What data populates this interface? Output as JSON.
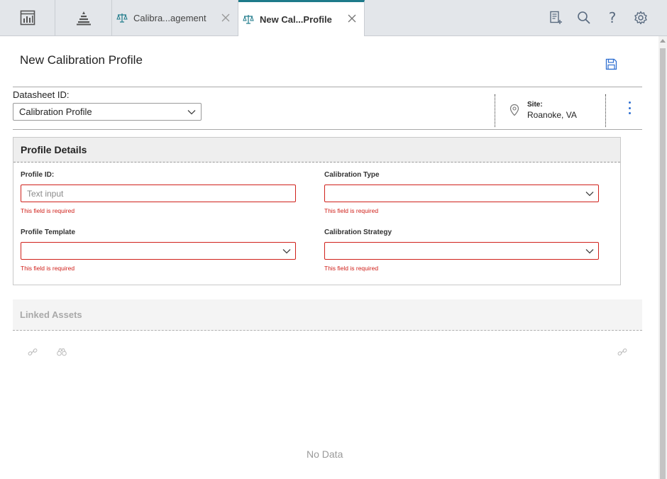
{
  "topbar": {
    "tabs": [
      {
        "label": "Calibra...agement",
        "active": false
      },
      {
        "label": "New Cal...Profile",
        "active": true
      }
    ],
    "icons": [
      "dashboard-icon",
      "pyramid-icon",
      "checklist-add-icon",
      "search-icon",
      "help-icon",
      "settings-icon"
    ],
    "help_glyph": "?"
  },
  "page": {
    "title": "New Calibration Profile"
  },
  "datasheet": {
    "label": "Datasheet ID:",
    "value": "Calibration Profile"
  },
  "site": {
    "label": "Site:",
    "value": "Roanoke, VA"
  },
  "profile_details": {
    "title": "Profile Details",
    "fields": [
      {
        "label": "Profile ID:",
        "type": "text",
        "placeholder": "Text input",
        "error": "This field is required"
      },
      {
        "label": "Calibration Type",
        "type": "select",
        "value": "",
        "error": "This field is required"
      },
      {
        "label": "Profile Template",
        "type": "select",
        "value": "",
        "error": "This field is required"
      },
      {
        "label": "Calibration Strategy",
        "type": "select",
        "value": "",
        "error": "This field is required"
      }
    ]
  },
  "linked_assets": {
    "title": "Linked Assets",
    "empty_text": "No Data"
  },
  "colors": {
    "accent": "#1e7a8a",
    "error": "#d0211b",
    "link_blue": "#2f6fd1",
    "topbar_bg": "#e3e6ea"
  }
}
